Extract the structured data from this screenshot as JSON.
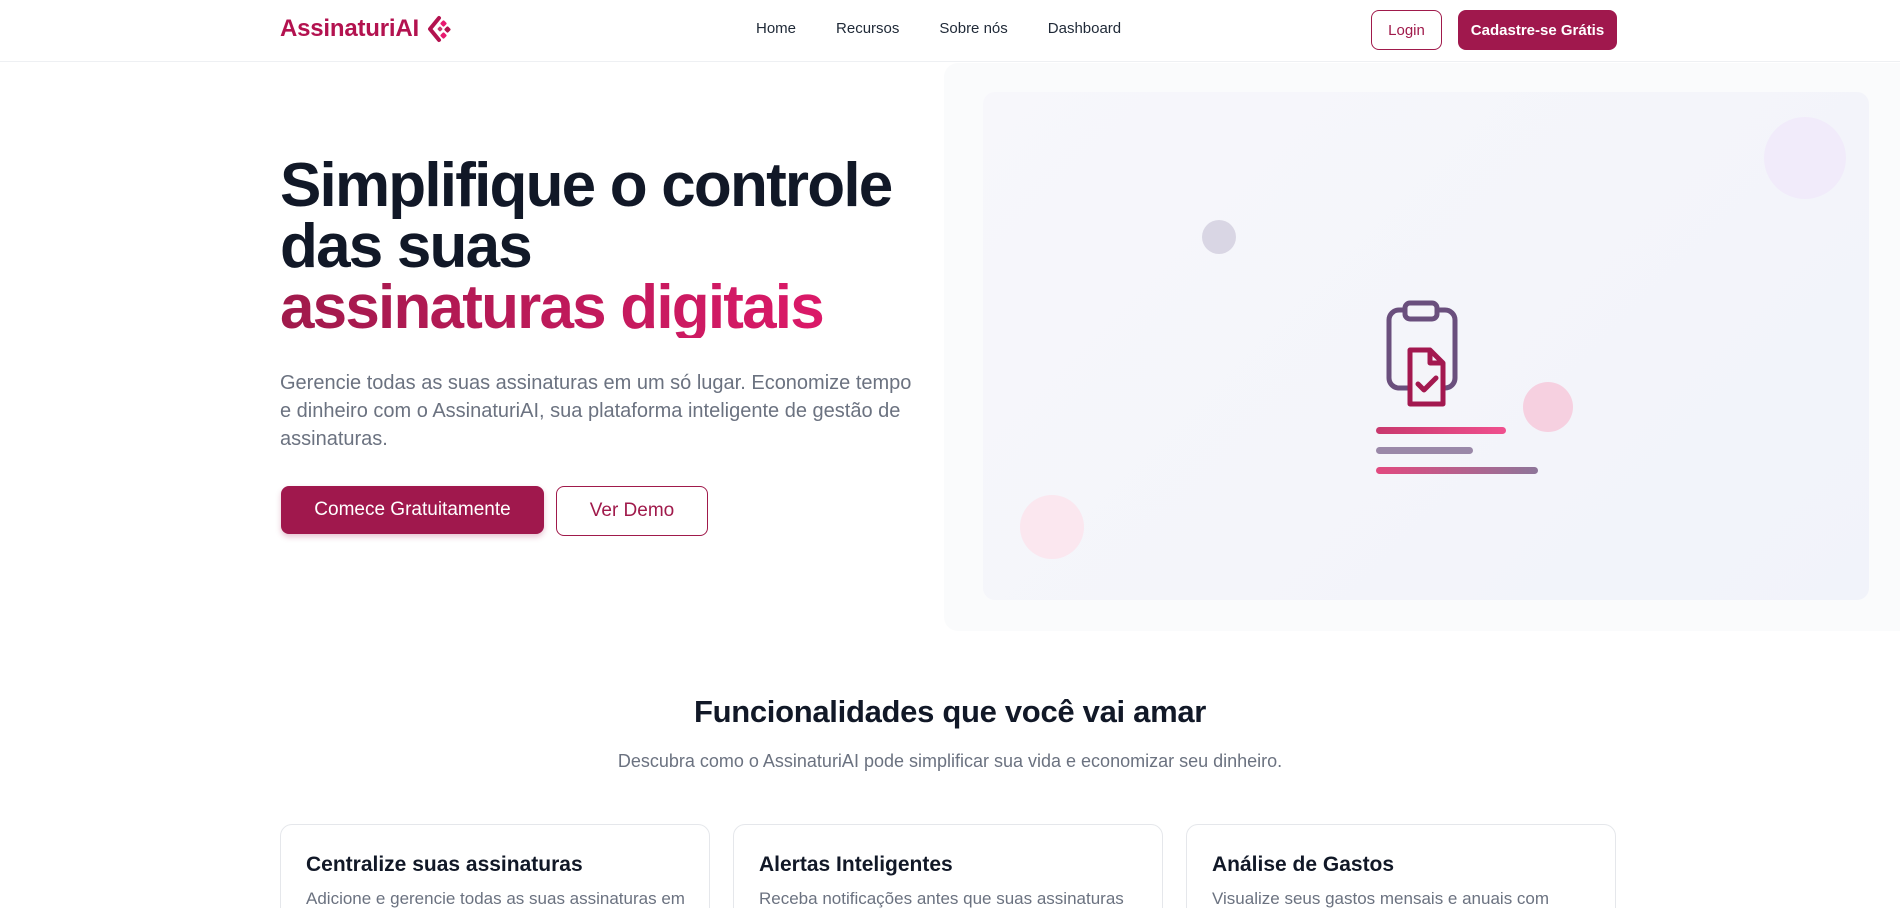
{
  "navbar": {
    "brand": "AssinaturiAI",
    "links": [
      "Home",
      "Recursos",
      "Sobre nós",
      "Dashboard"
    ],
    "login_label": "Login",
    "signup_label": "Cadastre-se Grátis"
  },
  "hero": {
    "title_line1": "Simplifique o controle",
    "title_line2": "das suas",
    "title_accent": "assinaturas digitais",
    "subtitle": "Gerencie todas as suas assinaturas em um só lugar. Economize tempo e dinheiro com o AssinaturiAI, sua plataforma inteligente de gestão de assinaturas.",
    "primary_cta": "Comece Gratuitamente",
    "secondary_cta": "Ver Demo",
    "illustration_icon": "clipboard-document-check-icon"
  },
  "features": {
    "title": "Funcionalidades que você vai amar",
    "subtitle": "Descubra como o AssinaturiAI pode simplificar sua vida e economizar seu dinheiro.",
    "cards": [
      {
        "title": "Centralize suas assinaturas",
        "text": "Adicione e gerencie todas as suas assinaturas em"
      },
      {
        "title": "Alertas Inteligentes",
        "text": "Receba notificações antes que suas assinaturas"
      },
      {
        "title": "Análise de Gastos",
        "text": "Visualize seus gastos mensais e anuais com"
      }
    ]
  },
  "colors": {
    "brand": "#a0184d",
    "accent_pink": "#e8196f",
    "text_dark": "#111827",
    "text_muted": "#6b7280"
  }
}
